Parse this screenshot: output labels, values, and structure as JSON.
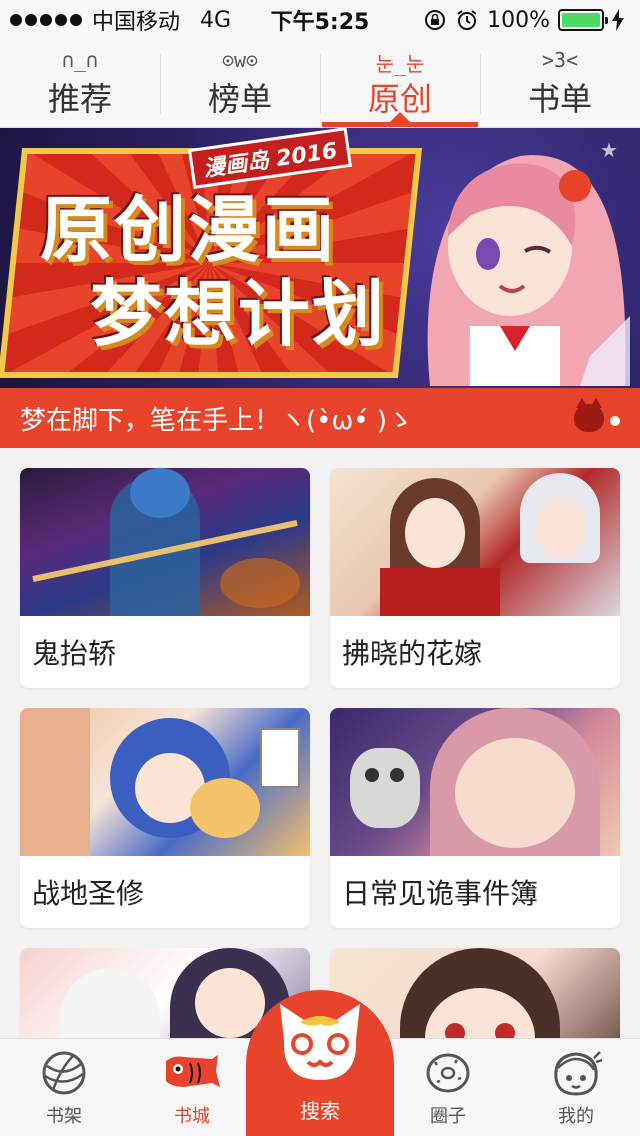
{
  "status_bar": {
    "carrier": "中国移动",
    "network": "4G",
    "time": "下午5:25",
    "battery": "100%"
  },
  "tabs": [
    {
      "face": "∩_∩",
      "label": "推荐",
      "active": false
    },
    {
      "face": "⊙w⊙",
      "label": "榜单",
      "active": false
    },
    {
      "face": "눈_눈",
      "label": "原创",
      "active": true
    },
    {
      "face": ">3<",
      "label": "书单",
      "active": false
    }
  ],
  "banner": {
    "tag": "漫画岛 2016",
    "title_line1": "原创漫画",
    "title_line2": "梦想计划",
    "caption": "梦在脚下，笔在手上！ヽ(•̀ω•́ )ゝ"
  },
  "cards": [
    {
      "title": "鬼抬轿"
    },
    {
      "title": "拂晓的花嫁"
    },
    {
      "title": "战地圣修"
    },
    {
      "title": "日常见诡事件簿"
    },
    {
      "title": ""
    },
    {
      "title": ""
    }
  ],
  "tabbar": {
    "items": [
      {
        "label": "书架",
        "icon": "yarn-ball-icon",
        "active": false
      },
      {
        "label": "书城",
        "icon": "carp-flag-icon",
        "active": true
      },
      {
        "label": "搜索",
        "icon": "cat-face-icon",
        "active": false
      },
      {
        "label": "圈子",
        "icon": "donut-icon",
        "active": false
      },
      {
        "label": "我的",
        "icon": "chibi-face-icon",
        "active": false
      }
    ]
  },
  "colors": {
    "accent": "#e8432b",
    "battery": "#4cd964"
  }
}
